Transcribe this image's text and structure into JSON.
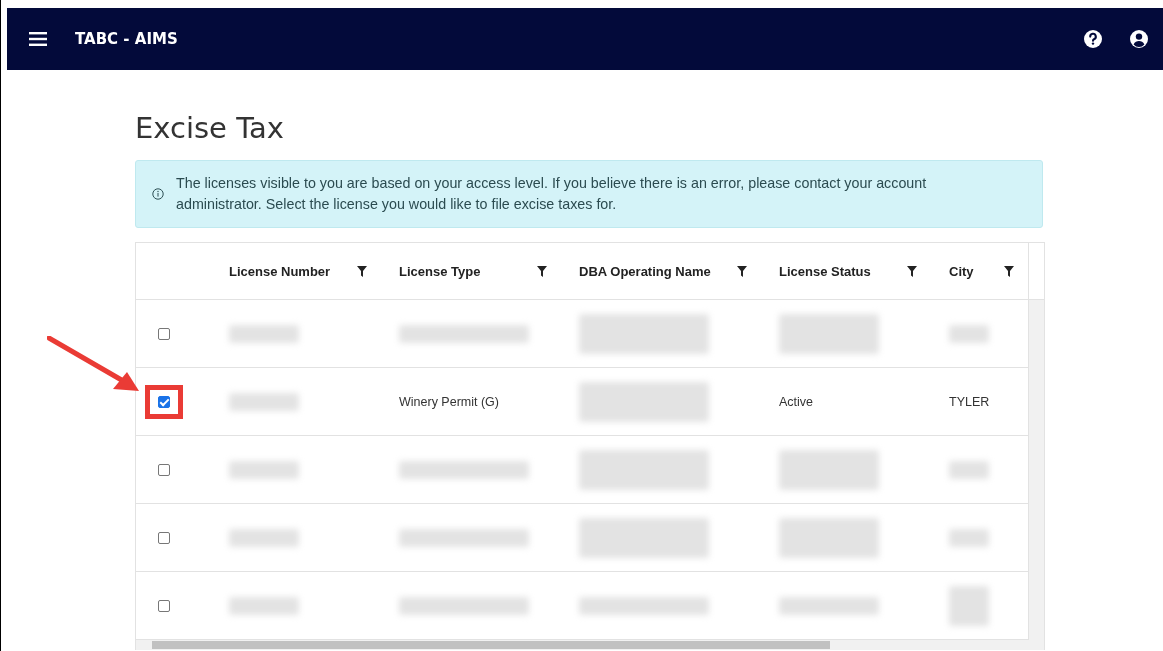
{
  "app_bar": {
    "title": "TABC - AIMS"
  },
  "page": {
    "title": "Excise Tax"
  },
  "alert": {
    "text": "The licenses visible to you are based on your access level. If you believe there is an error, please contact your account administrator. Select the license you would like to file excise taxes for."
  },
  "table": {
    "columns": [
      "License Number",
      "License Type",
      "DBA Operating Name",
      "License Status",
      "City"
    ],
    "rows": [
      {
        "selected": false,
        "highlighted": false,
        "cells": [
          {
            "kind": "redacted"
          },
          {
            "kind": "redacted"
          },
          {
            "kind": "redacted2"
          },
          {
            "kind": "redacted2"
          },
          {
            "kind": "redacted"
          }
        ]
      },
      {
        "selected": true,
        "highlighted": true,
        "cells": [
          {
            "kind": "redacted"
          },
          {
            "kind": "text",
            "text": "Winery Permit (G)"
          },
          {
            "kind": "redacted2"
          },
          {
            "kind": "text",
            "text": "Active"
          },
          {
            "kind": "text",
            "text": "TYLER"
          }
        ]
      },
      {
        "selected": false,
        "highlighted": false,
        "cells": [
          {
            "kind": "redacted"
          },
          {
            "kind": "redacted"
          },
          {
            "kind": "redacted2"
          },
          {
            "kind": "redacted2"
          },
          {
            "kind": "redacted"
          }
        ]
      },
      {
        "selected": false,
        "highlighted": false,
        "cells": [
          {
            "kind": "redacted"
          },
          {
            "kind": "redacted"
          },
          {
            "kind": "redacted2"
          },
          {
            "kind": "redacted2"
          },
          {
            "kind": "redacted"
          }
        ]
      },
      {
        "selected": false,
        "highlighted": false,
        "cells": [
          {
            "kind": "redacted"
          },
          {
            "kind": "redacted"
          },
          {
            "kind": "redacted"
          },
          {
            "kind": "redacted"
          },
          {
            "kind": "redacted2"
          }
        ]
      }
    ]
  }
}
